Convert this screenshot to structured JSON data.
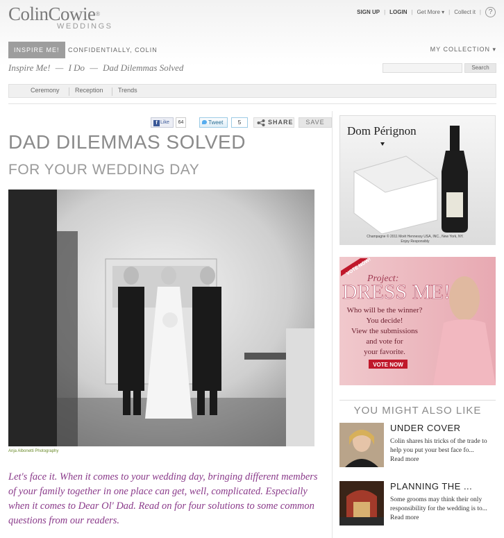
{
  "brand": {
    "name": "ColinCowie",
    "reg": "®",
    "sub": "WEDDINGS"
  },
  "toplinks": {
    "signup": "SIGN UP",
    "login": "LOGIN",
    "getmore": "Get More ▾",
    "collect": "Collect it",
    "help": "?"
  },
  "nav": {
    "tab_active": "INSPIRE ME!",
    "tab2": "CONFIDENTIALLY, COLIN",
    "collection": "MY COLLECTION ▾"
  },
  "breadcrumb": {
    "item1": "Inspire Me!",
    "sep1": "—",
    "item2": "I Do",
    "sep2": "—",
    "item3": "Dad Dilemmas Solved"
  },
  "search": {
    "placeholder": "",
    "button": "Search"
  },
  "subnav": {
    "items": [
      "Ceremony",
      "Reception",
      "Trends"
    ]
  },
  "social": {
    "fb_label": "Like",
    "fb_count": "64",
    "tw_label": "Tweet",
    "tw_count": "5",
    "share_label": "SHARE",
    "save_label": "SAVE"
  },
  "article": {
    "title": "DAD DILEMMAS SOLVED",
    "subtitle": "FOR YOUR WEDDING DAY",
    "photo_credit": "Anja Albonetti Photography",
    "intro": "Let's face it. When it comes to your wedding day, bringing different members of your family together in one place can get, well, complicated. Especially when it comes to Dear Ol' Dad. Read on for four solutions to some common questions from our readers."
  },
  "ads": {
    "dom_brand": "Dom Pérignon",
    "dom_fine": "Champagne © 2011 Moët Hennessy USA, INC., New York, NY.",
    "dom_fine2": "Enjoy Responsibly",
    "dress_badge": "VOTE NOW!",
    "dress_project": "Project:",
    "dress_title": "DRESS ME!",
    "dress_lines": [
      "Who will be the winner?",
      "You decide!",
      "View the submissions",
      "and vote for",
      "your favorite."
    ],
    "dress_button": "VOTE NOW"
  },
  "also": {
    "heading": "YOU MIGHT ALSO LIKE",
    "items": [
      {
        "title": "UNDER COVER",
        "desc": "Colin shares his tricks of the trade to help you put your best face fo...",
        "more": "Read more"
      },
      {
        "title": "PLANNING THE ...",
        "desc": "Some grooms may think their only responsibility for the wedding is to...",
        "more": "Read more"
      }
    ]
  },
  "colors": {
    "accent_purple": "#8a3a8a",
    "nav_active": "#9d9d9d",
    "ad_pink": "#b04a5f",
    "vote_red": "#c0182b"
  }
}
